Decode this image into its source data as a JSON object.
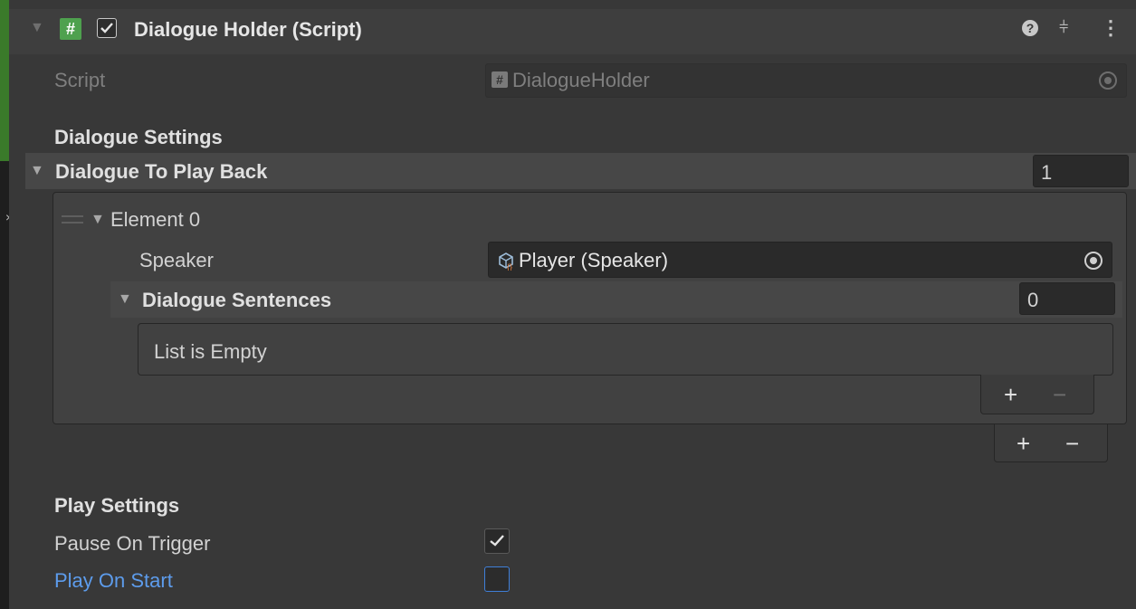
{
  "component": {
    "title": "Dialogue Holder (Script)",
    "enabled": true,
    "script_label": "Script",
    "script_value": "DialogueHolder"
  },
  "icons": {
    "fold": "triangle-down-icon",
    "script": "hash-icon",
    "help": "help-icon",
    "presets": "presets-icon",
    "menu": "kebab-menu-icon",
    "object_picker": "target-icon",
    "scriptable_object": "scriptable-object-icon"
  },
  "dialogue_settings": {
    "header": "Dialogue Settings",
    "list_label": "Dialogue To Play Back",
    "list_size": "1",
    "element": {
      "label": "Element 0",
      "speaker_label": "Speaker",
      "speaker_value": "Player (Speaker)",
      "sentences_label": "Dialogue Sentences",
      "sentences_size": "0",
      "empty_text": "List is Empty"
    }
  },
  "play_settings": {
    "header": "Play Settings",
    "pause_on_trigger_label": "Pause On Trigger",
    "pause_on_trigger": true,
    "play_on_start_label": "Play On Start",
    "play_on_start": false
  },
  "buttons": {
    "add": "+",
    "remove": "−"
  },
  "colors": {
    "background": "#383838",
    "field": "#2a2a2a",
    "script_icon": "#4ea14e",
    "focus_blue": "#5d9cec"
  }
}
